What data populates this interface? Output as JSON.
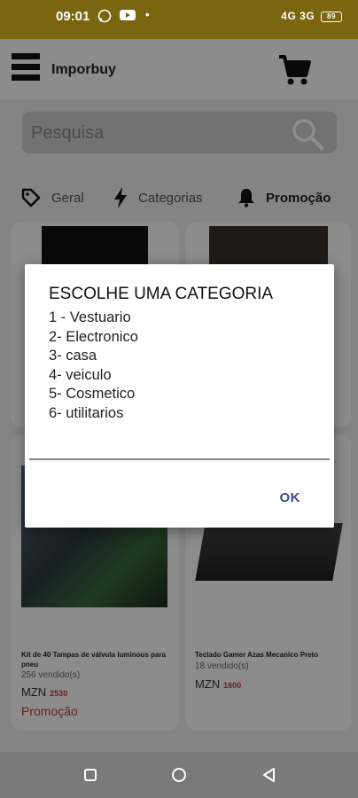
{
  "status_bar": {
    "time": "09:01",
    "notification_icons": [
      "whatsapp-icon",
      "youtube-icon",
      "dot-icon"
    ],
    "signal_text": "4G 3G",
    "battery": "89"
  },
  "app_bar": {
    "title": "Imporbuy"
  },
  "search": {
    "placeholder": "Pesquisa"
  },
  "tabs": [
    {
      "label": "Geral",
      "icon": "tag-icon"
    },
    {
      "label": "Categorias",
      "icon": "bolt-icon"
    },
    {
      "label": "Promoção",
      "icon": "bell-icon"
    }
  ],
  "products": [
    {
      "name": "Kit de 40 Tampas de válvula luminous para pneu",
      "sold": "256 vendido(s)",
      "currency": "MZN",
      "price": "2530",
      "promo": "Promoção"
    },
    {
      "name": "Teclado Gamer Azas Mecanico Preto",
      "sold": "18 vendido(s)",
      "currency": "MZN",
      "price": "1600",
      "promo": ""
    }
  ],
  "dialog": {
    "title": "ESCOLHE UMA CATEGORIA",
    "options": [
      "1 - Vestuario",
      "2- Electronico",
      "3- casa",
      "4- veiculo",
      "5- Cosmetico",
      "6- utilitarios"
    ],
    "ok_label": "OK"
  },
  "colors": {
    "status_bar": "#7a6510",
    "price_accent": "#c0392b",
    "dialog_button": "#3a4a8c"
  }
}
